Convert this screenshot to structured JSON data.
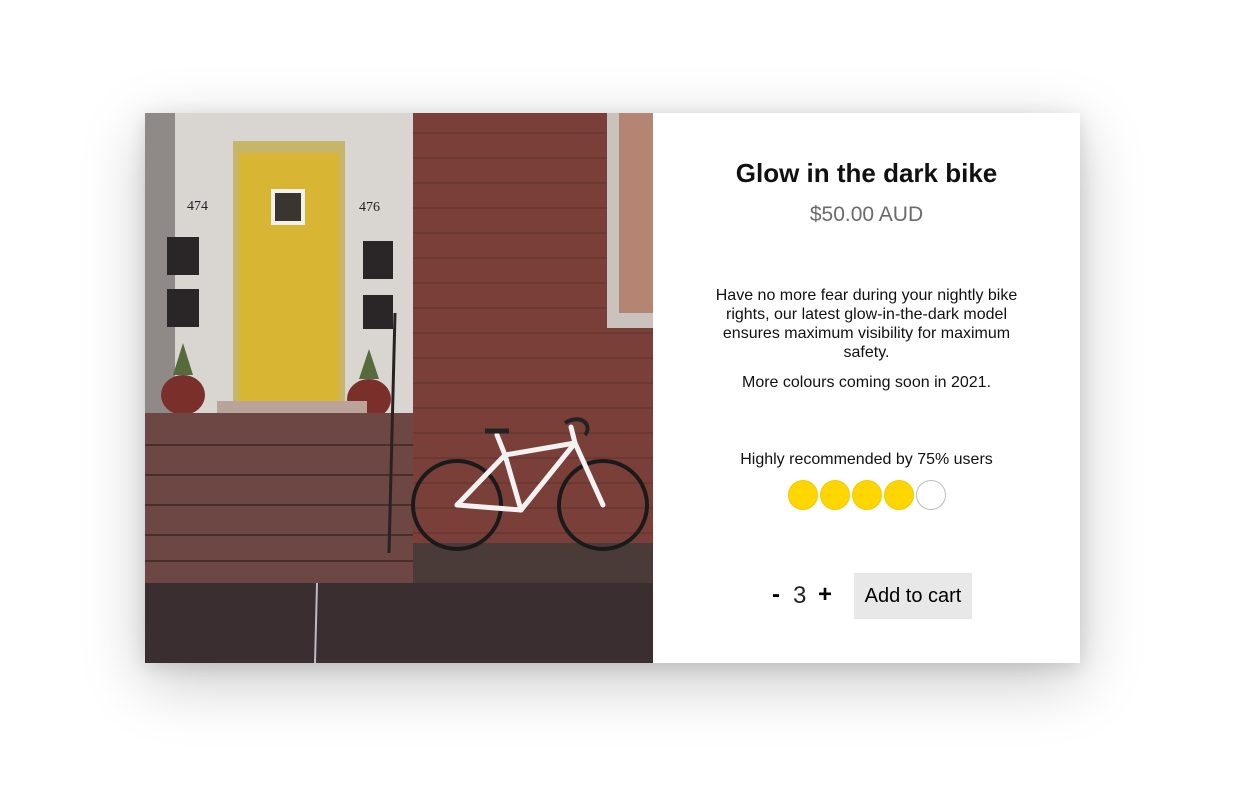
{
  "product": {
    "title": "Glow in the dark bike",
    "price": "$50.00 AUD",
    "description": "Have no more fear during your nightly bike rights, our latest glow-in-the-dark model ensures maximum visibility for maximum safety.",
    "description_2": "More colours coming soon in 2021.",
    "recommendation": "Highly recommended by 75% users",
    "rating": {
      "filled": 4,
      "total": 5,
      "filled_color": "#ffd600",
      "empty_color": "#ffffff"
    },
    "photo": {
      "house_number_left": "474",
      "house_number_right": "476"
    }
  },
  "cart": {
    "decrement_label": "-",
    "quantity": "3",
    "increment_label": "+",
    "add_label": "Add to cart"
  }
}
